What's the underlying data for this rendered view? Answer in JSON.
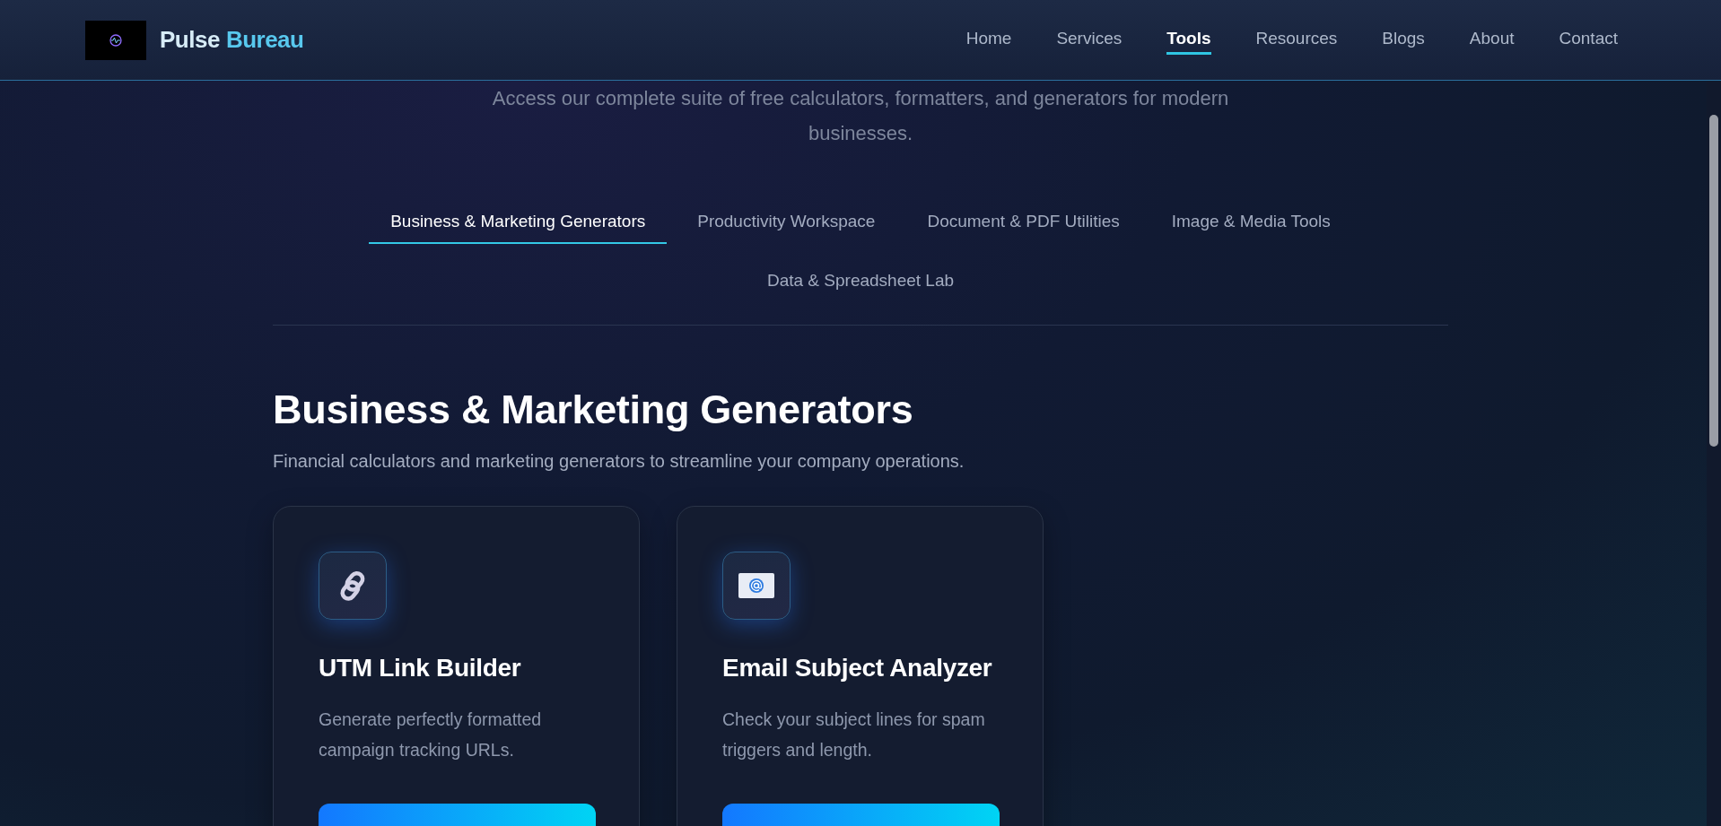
{
  "header": {
    "brand": [
      "Pulse",
      "Bureau"
    ],
    "nav": [
      {
        "label": "Home",
        "selected": false
      },
      {
        "label": "Services",
        "selected": false
      },
      {
        "label": "Tools",
        "selected": true
      },
      {
        "label": "Resources",
        "selected": false
      },
      {
        "label": "Blogs",
        "selected": false
      },
      {
        "label": "About",
        "selected": false
      },
      {
        "label": "Contact",
        "selected": false
      }
    ]
  },
  "intro": "Access our complete suite of free calculators, formatters, and generators for modern businesses.",
  "tabs": [
    {
      "label": "Business & Marketing Generators",
      "selected": true
    },
    {
      "label": "Productivity Workspace",
      "selected": false
    },
    {
      "label": "Document & PDF Utilities",
      "selected": false
    },
    {
      "label": "Image & Media Tools",
      "selected": false
    },
    {
      "label": "Data & Spreadsheet Lab",
      "selected": false
    }
  ],
  "section": {
    "title": "Business & Marketing Generators",
    "description": "Financial calculators and marketing generators to streamline your company operations.",
    "cards": [
      {
        "kind": "link",
        "title": "UTM Link Builder",
        "description": "Generate perfectly formatted campaign tracking URLs."
      },
      {
        "kind": "email",
        "title": "Email Subject Analyzer",
        "description": "Check your subject lines for spam triggers and length."
      }
    ]
  }
}
